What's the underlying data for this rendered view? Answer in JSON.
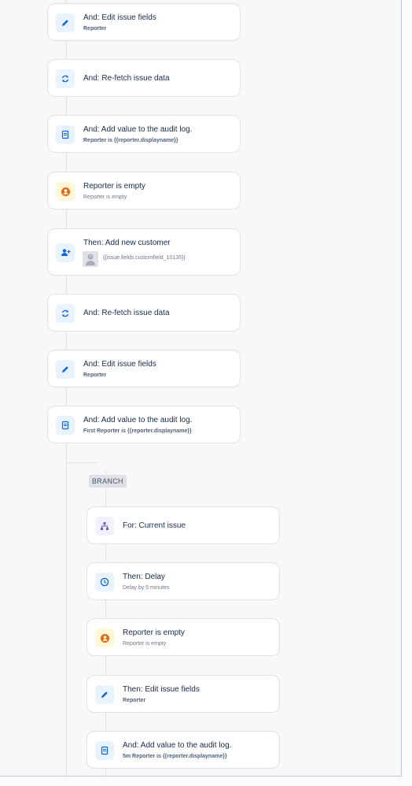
{
  "branch_label": "BRANCH",
  "main_steps": [
    {
      "icon": "pencil-icon",
      "title": "And: Edit issue fields",
      "subtitle": "Reporter"
    },
    {
      "icon": "refresh-icon",
      "title": "And: Re-fetch issue data",
      "subtitle": ""
    },
    {
      "icon": "audit-log-icon",
      "title": "And: Add value to the audit log.",
      "subtitle": "Reporter is {{reporter.displayname}}"
    },
    {
      "icon": "user-condition-icon",
      "title": "Reporter is empty",
      "subtitle": "Reporter is empty"
    },
    {
      "icon": "add-customer-icon",
      "title": "Then: Add new customer",
      "subtitle": "{{issue.fields.customfield_10135}}"
    },
    {
      "icon": "refresh-icon",
      "title": "And: Re-fetch issue data",
      "subtitle": ""
    },
    {
      "icon": "pencil-icon",
      "title": "And: Edit issue fields",
      "subtitle": "Reporter"
    },
    {
      "icon": "audit-log-icon",
      "title": "And: Add value to the audit log.",
      "subtitle": "First Reporter is {{reporter.displayname}}"
    }
  ],
  "branch_steps": [
    {
      "icon": "branch-icon",
      "title": "For: Current issue",
      "subtitle": ""
    },
    {
      "icon": "clock-icon",
      "title": "Then: Delay",
      "subtitle": "Delay by 5 minutes"
    },
    {
      "icon": "user-condition-icon",
      "title": "Reporter is empty",
      "subtitle": "Reporter is empty"
    },
    {
      "icon": "pencil-icon",
      "title": "Then: Edit issue fields",
      "subtitle": "Reporter"
    },
    {
      "icon": "audit-log-icon",
      "title": "And: Add value to the audit log.",
      "subtitle": "5m Reporter is {{reporter.displayname}}"
    }
  ]
}
